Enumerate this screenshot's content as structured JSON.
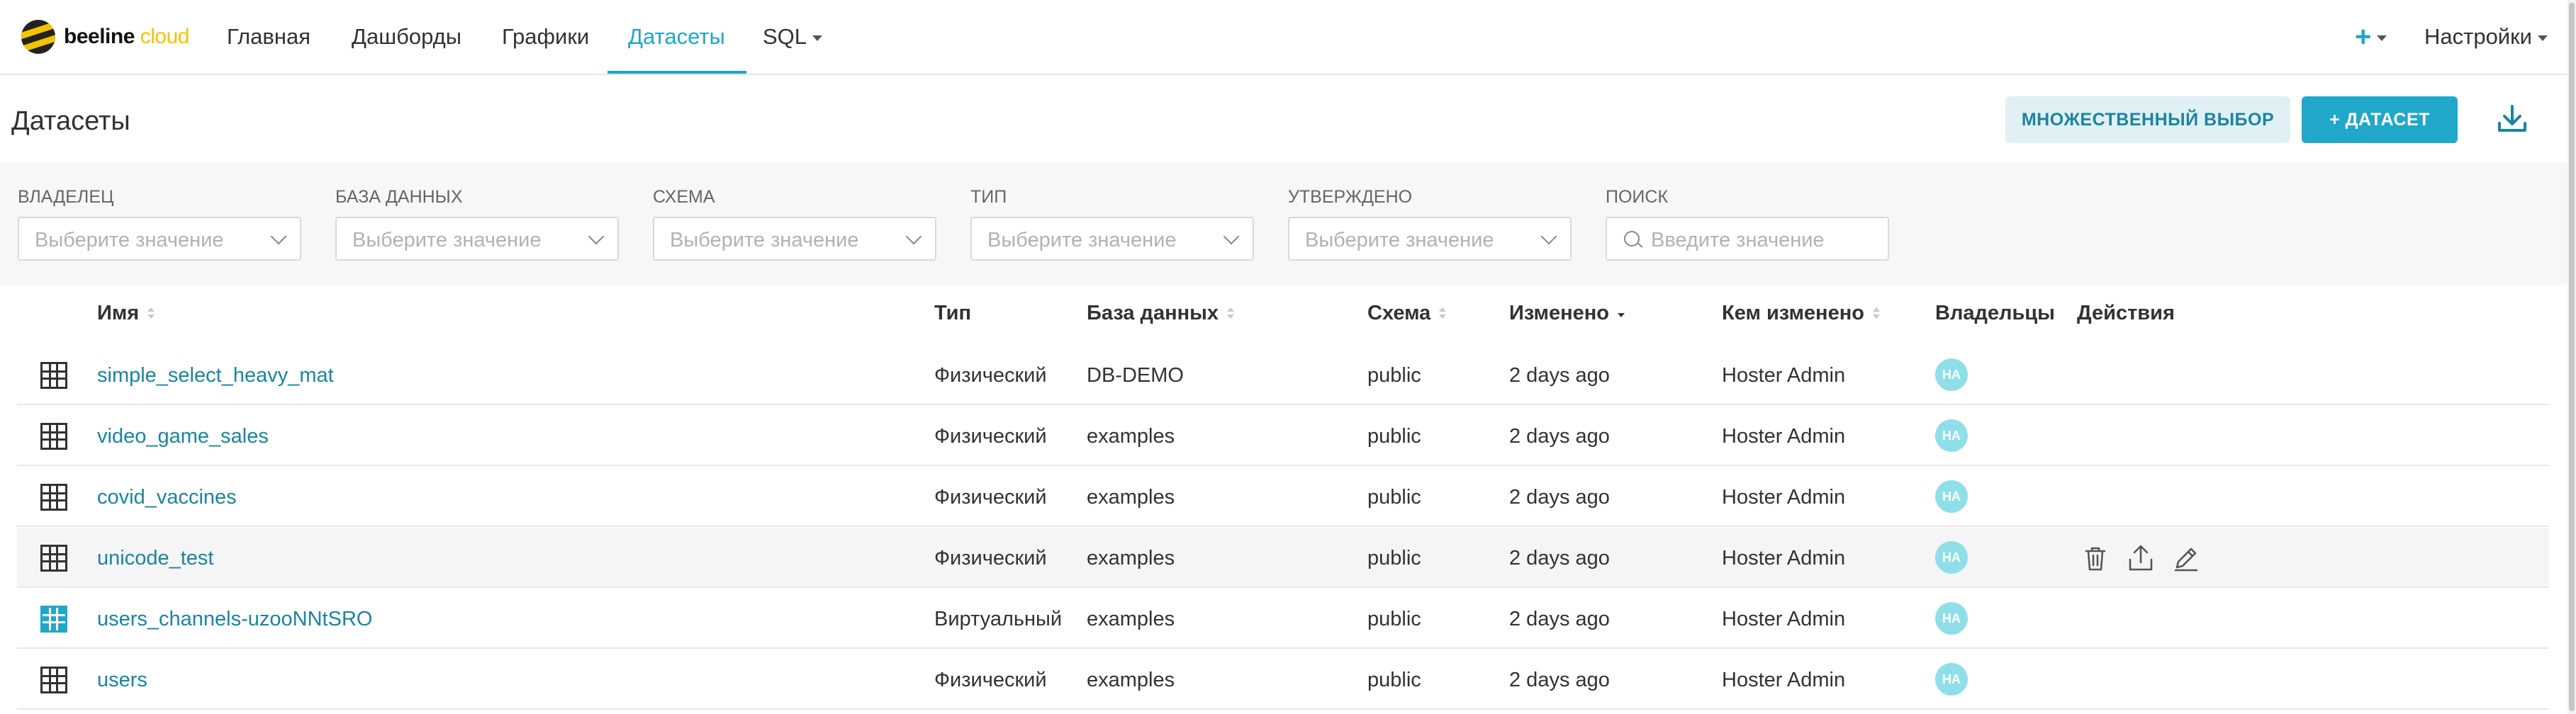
{
  "brand": {
    "name": "beeline",
    "suffix": "cloud"
  },
  "nav": {
    "items": [
      {
        "label": "Главная"
      },
      {
        "label": "Дашборды"
      },
      {
        "label": "Графики"
      },
      {
        "label": "Датасеты",
        "active": true
      },
      {
        "label": "SQL",
        "dropdown": true
      }
    ],
    "plus_icon": "plus-icon",
    "settings_label": "Настройки"
  },
  "page": {
    "title": "Датасеты",
    "multi_select_label": "МНОЖЕСТВЕННЫЙ ВЫБОР",
    "add_dataset_label": "+ ДАТАСЕТ",
    "download_icon": "download-icon"
  },
  "filters": [
    {
      "label": "ВЛАДЕЛЕЦ",
      "placeholder": "Выберите значение",
      "kind": "select"
    },
    {
      "label": "БАЗА ДАННЫХ",
      "placeholder": "Выберите значение",
      "kind": "select"
    },
    {
      "label": "СХЕМА",
      "placeholder": "Выберите значение",
      "kind": "select"
    },
    {
      "label": "ТИП",
      "placeholder": "Выберите значение",
      "kind": "select"
    },
    {
      "label": "УТВЕРЖДЕНО",
      "placeholder": "Выберите значение",
      "kind": "select"
    },
    {
      "label": "ПОИСК",
      "placeholder": "Введите значение",
      "kind": "search"
    }
  ],
  "table": {
    "columns": {
      "name": "Имя",
      "type": "Тип",
      "database": "База данных",
      "schema": "Схема",
      "changed": "Изменено",
      "changed_by": "Кем изменено",
      "owners": "Владельцы",
      "actions": "Действия"
    },
    "rows": [
      {
        "icon": "table-icon",
        "name": "simple_select_heavy_mat",
        "type": "Физический",
        "database": "DB-DEMO",
        "schema": "public",
        "changed": "2 days ago",
        "changed_by": "Hoster Admin",
        "owner": "HA"
      },
      {
        "icon": "table-icon",
        "name": "video_game_sales",
        "type": "Физический",
        "database": "examples",
        "schema": "public",
        "changed": "2 days ago",
        "changed_by": "Hoster Admin",
        "owner": "HA"
      },
      {
        "icon": "table-icon",
        "name": "covid_vaccines",
        "type": "Физический",
        "database": "examples",
        "schema": "public",
        "changed": "2 days ago",
        "changed_by": "Hoster Admin",
        "owner": "HA"
      },
      {
        "icon": "table-icon",
        "name": "unicode_test",
        "type": "Физический",
        "database": "examples",
        "schema": "public",
        "changed": "2 days ago",
        "changed_by": "Hoster Admin",
        "owner": "HA",
        "hover": true,
        "actions": [
          "trash-icon",
          "share-icon",
          "edit-icon"
        ]
      },
      {
        "icon": "virtual-table-icon",
        "name": "users_channels-uzooNNtSRO",
        "type": "Виртуальный",
        "database": "examples",
        "schema": "public",
        "changed": "2 days ago",
        "changed_by": "Hoster Admin",
        "owner": "HA"
      },
      {
        "icon": "table-icon",
        "name": "users",
        "type": "Физический",
        "database": "examples",
        "schema": "public",
        "changed": "2 days ago",
        "changed_by": "Hoster Admin",
        "owner": "HA"
      }
    ]
  },
  "colors": {
    "accent": "#20a7c9",
    "link": "#1985a0",
    "avatar": "#8fdfe8",
    "brand_yellow": "#f4c300"
  }
}
